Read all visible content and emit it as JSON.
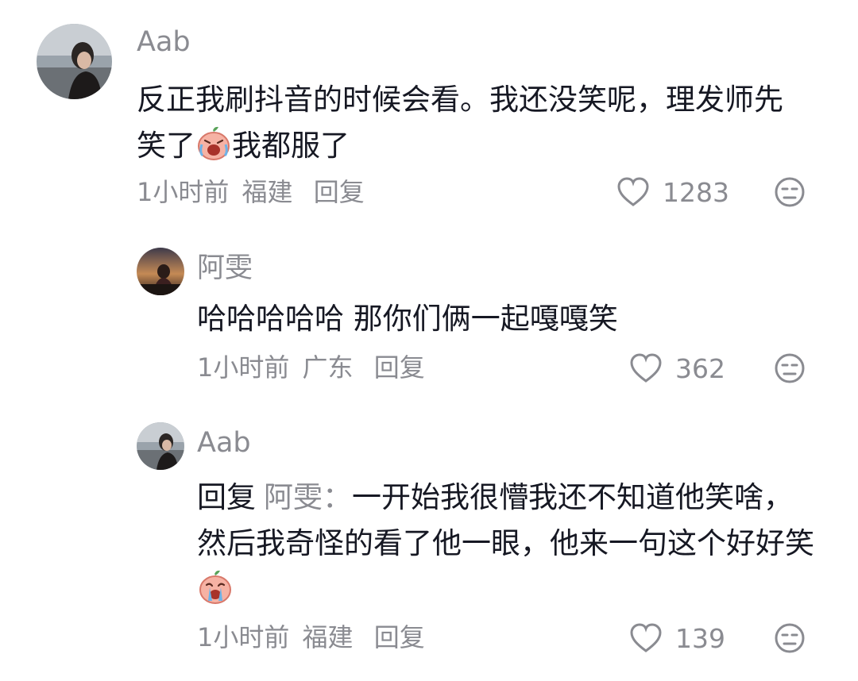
{
  "comments": [
    {
      "username": "Aab",
      "text_before_emoji": "反正我刷抖音的时候会看。我还没笑呢，理发师先笑了",
      "text_after_emoji": "我都服了",
      "emoji": "laughing-crying-peach-emoji",
      "time": "1小时前",
      "location": "福建",
      "reply_label": "回复",
      "likes": "1283"
    },
    {
      "username": "阿雯",
      "text": "哈哈哈哈哈 那你们俩一起嘎嘎笑",
      "time": "1小时前",
      "location": "广东",
      "reply_label": "回复",
      "likes": "362"
    },
    {
      "username": "Aab",
      "reply_prefix": "回复",
      "reply_to": "阿雯：",
      "text": "一开始我很懵我还不知道他笑啥，然后我奇怪的看了他一眼，他来一句这个好好笑",
      "emoji": "crying-peach-emoji",
      "time": "1小时前",
      "location": "福建",
      "reply_label": "回复",
      "likes": "139"
    }
  ],
  "colors": {
    "text": "#161823",
    "secondary": "#8a8b91"
  }
}
